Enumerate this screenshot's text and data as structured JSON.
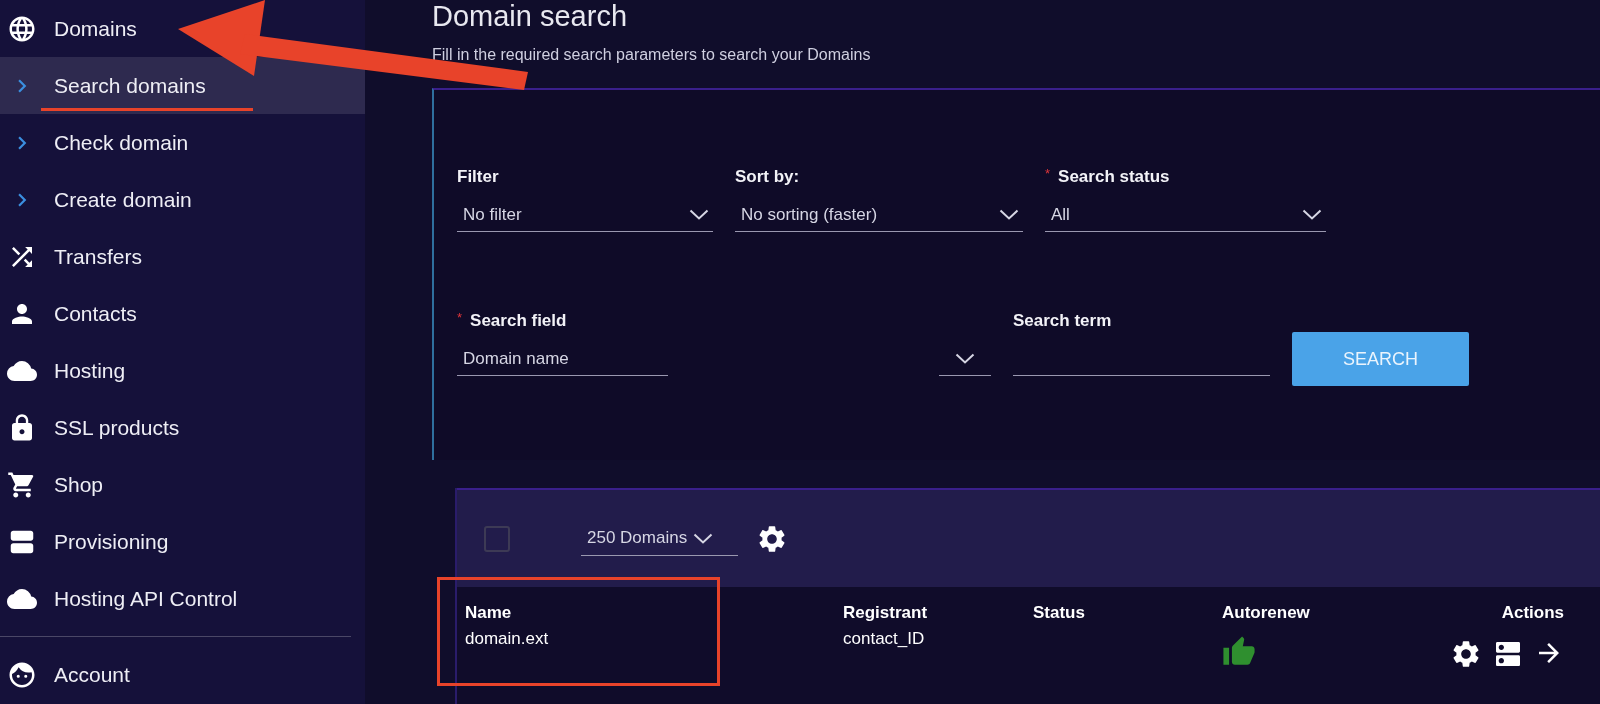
{
  "sidebar": {
    "items": [
      {
        "kind": "section",
        "label": "Domains",
        "selected": false
      },
      {
        "kind": "sub",
        "label": "Search domains",
        "selected": true
      },
      {
        "kind": "sub",
        "label": "Check domain",
        "selected": false
      },
      {
        "kind": "sub",
        "label": "Create domain",
        "selected": false
      },
      {
        "kind": "section",
        "label": "Transfers",
        "selected": false
      },
      {
        "kind": "section",
        "label": "Contacts",
        "selected": false
      },
      {
        "kind": "section",
        "label": "Hosting",
        "selected": false
      },
      {
        "kind": "section",
        "label": "SSL products",
        "selected": false
      },
      {
        "kind": "section",
        "label": "Shop",
        "selected": false
      },
      {
        "kind": "section",
        "label": "Provisioning",
        "selected": false
      },
      {
        "kind": "section",
        "label": "Hosting API Control",
        "selected": false
      }
    ],
    "account": {
      "label": "Account",
      "selected": false
    }
  },
  "page": {
    "title": "Domain search",
    "subtitle": "Fill in the required search parameters to search your Domains"
  },
  "search_form": {
    "row_1": [
      {
        "label": "Filter",
        "value": "No filter"
      },
      {
        "label": "Sort by:",
        "value": "No sorting (faster)"
      },
      {
        "label": "Search status",
        "required_mark": "*",
        "value": "All"
      }
    ],
    "search_field": {
      "label": "Search field",
      "required_mark": "*",
      "value": "Domain name"
    },
    "search_term": {
      "label": "Search term"
    },
    "button": "SEARCH"
  },
  "results": {
    "select_all_checked": false,
    "page_size": "250 Domains",
    "columns": [
      "Name",
      "Registrant",
      "Status",
      "Autorenew",
      "Actions"
    ],
    "rows": [
      {
        "name": "domain.ext",
        "registrant": "contact_ID",
        "autorenew": true
      }
    ]
  }
}
